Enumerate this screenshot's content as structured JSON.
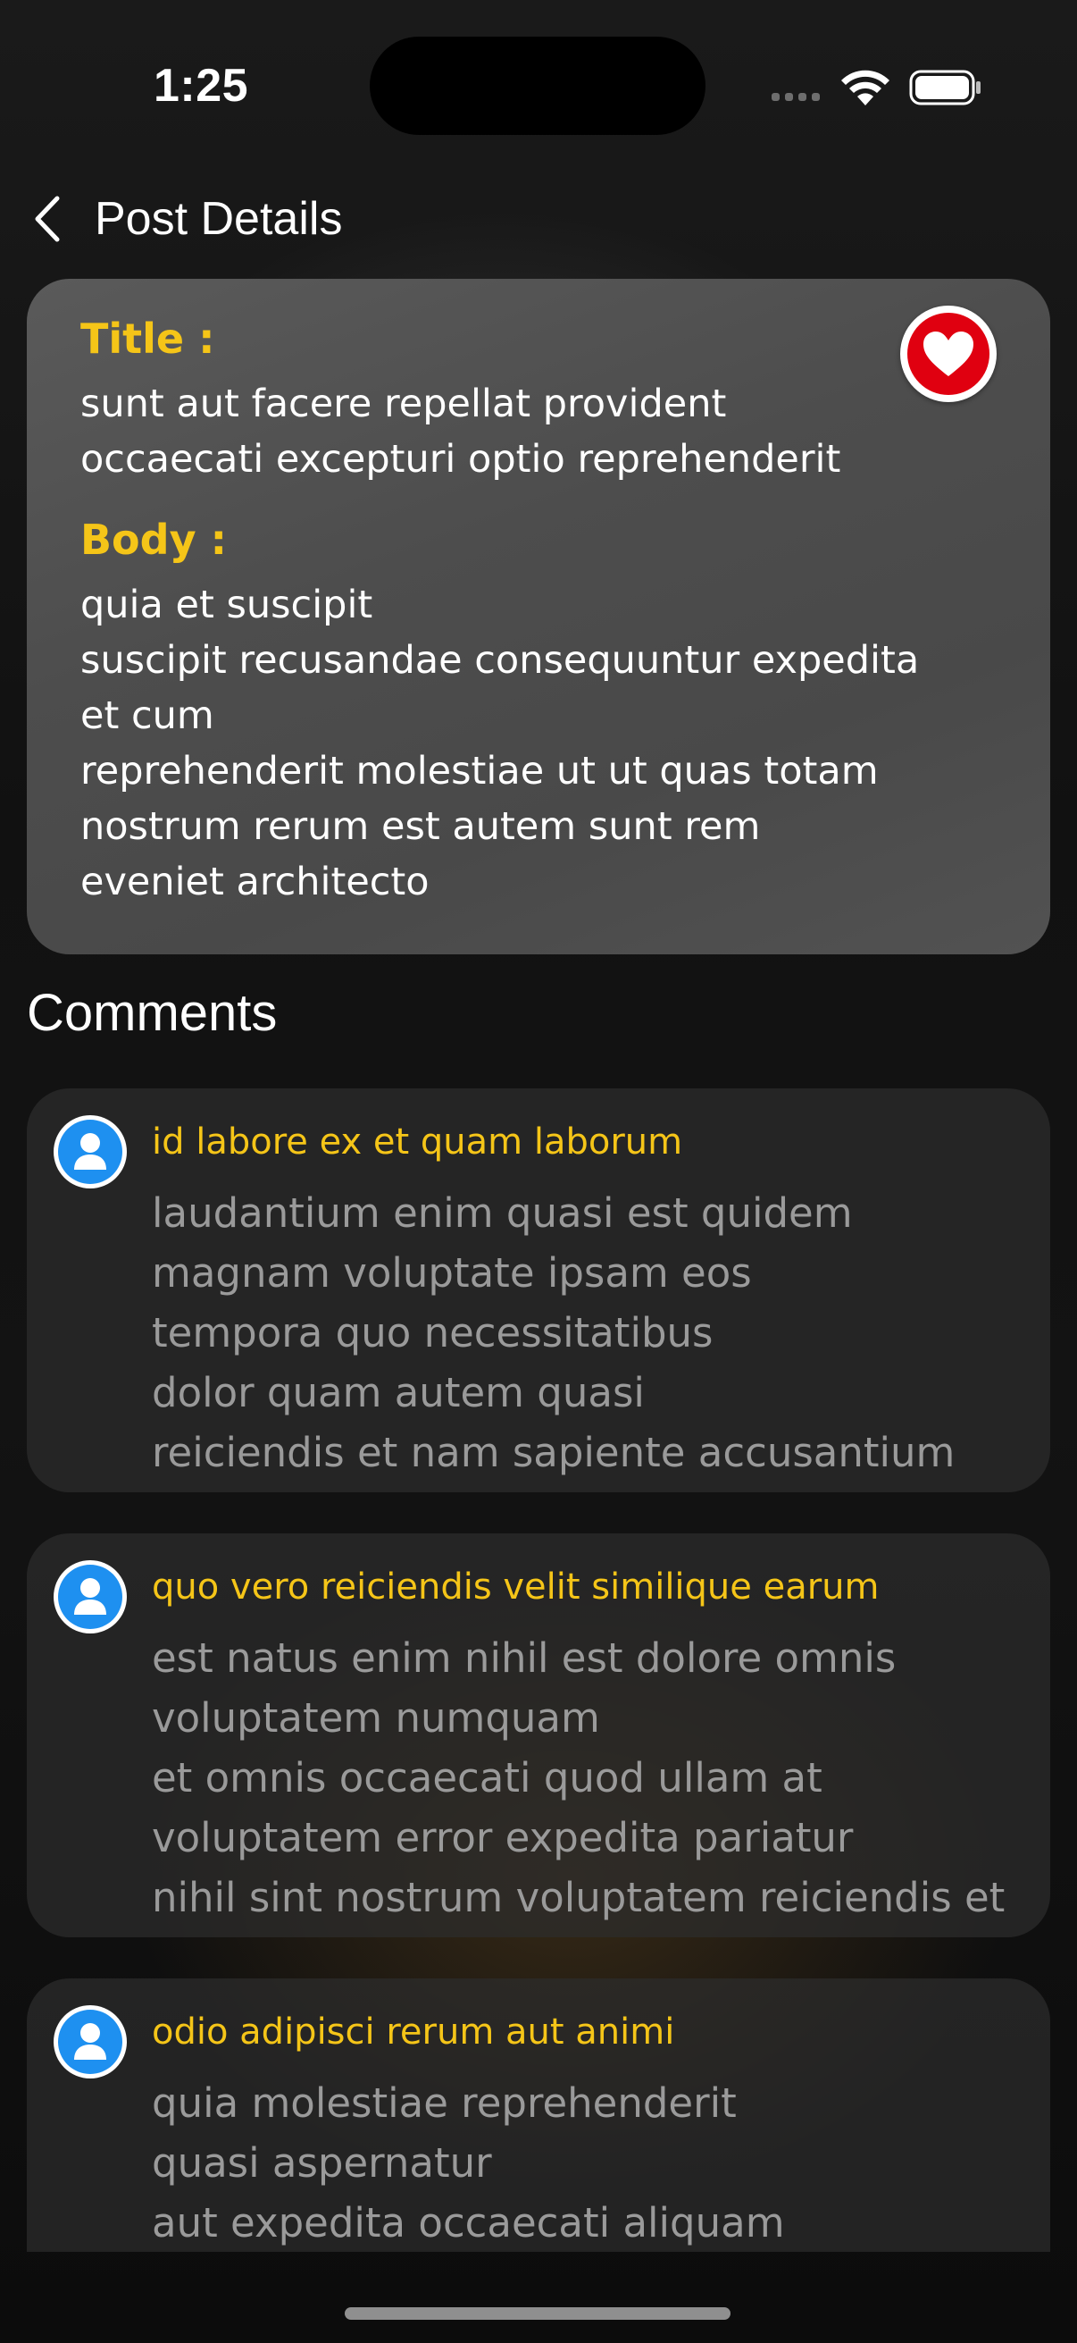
{
  "status_bar": {
    "time": "1:25"
  },
  "nav": {
    "back_icon": "chevron-left-icon",
    "title": "Post Details"
  },
  "post": {
    "title_label": "Title :",
    "title": "sunt aut facere repellat provident\noccaecati excepturi optio reprehenderit",
    "body_label": "Body :",
    "body": "quia et suscipit\nsuscipit recusandae consequuntur expedita\net cum\nreprehenderit molestiae ut ut quas totam\nnostrum rerum est autem sunt rem\neveniet architecto",
    "favorite_icon": "heart-icon",
    "favorite_color": "#e00010"
  },
  "comments_heading": "Comments",
  "comments": [
    {
      "name": "id labore ex et quam laborum",
      "body": "laudantium enim quasi est quidem\nmagnam voluptate ipsam eos\ntempora quo necessitatibus\ndolor quam autem quasi\nreiciendis et nam sapiente accusantium"
    },
    {
      "name": "quo vero reiciendis velit similique earum",
      "body": "est natus enim nihil est dolore omnis\nvoluptatem numquam\net omnis occaecati quod ullam at\nvoluptatem error expedita pariatur\nnihil sint nostrum voluptatem reiciendis et"
    },
    {
      "name": "odio adipisci rerum aut animi",
      "body": "quia molestiae reprehenderit\nquasi aspernatur\naut expedita occaecati aliquam"
    }
  ],
  "colors": {
    "accent": "#f5c518",
    "avatar": "#1e90f0",
    "comment_text": "#9a9a9a"
  }
}
